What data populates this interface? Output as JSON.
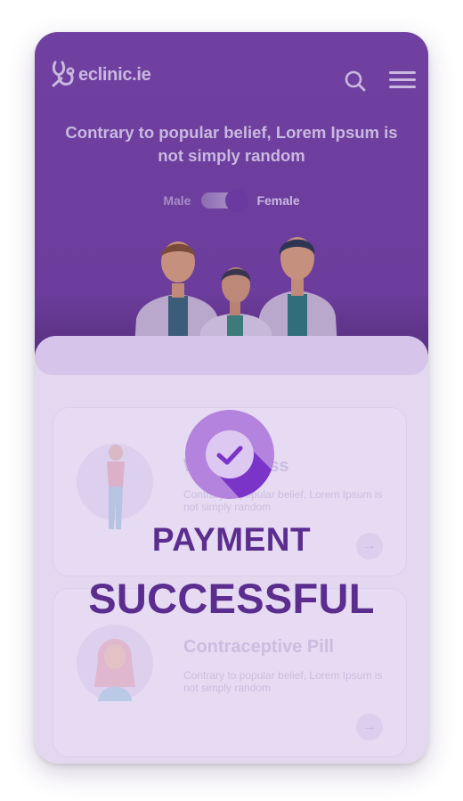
{
  "header": {
    "logo_text": "eclinic.ie",
    "icons": {
      "search": "search-icon",
      "menu": "hamburger-menu-icon"
    }
  },
  "hero": {
    "headline": "Contrary to popular belief, Lorem Ipsum is not simply random",
    "toggle": {
      "left_label": "Male",
      "right_label": "Female",
      "selected": "Female"
    }
  },
  "cards": [
    {
      "title": "Weight Loss",
      "description": "Contrary to popular belief, Lorem Ipsum is not simply random",
      "arrow_icon": "arrow-right-icon"
    },
    {
      "title": "Contraceptive Pill",
      "description": "Contrary to popular belief, Lorem Ipsum is not simply random",
      "arrow_icon": "arrow-right-icon"
    }
  ],
  "overlay": {
    "status_icon": "check-circle-icon",
    "line1": "PAYMENT",
    "line2": "SUCCESSFUL"
  },
  "colors": {
    "brand_purple": "#6c3d9c",
    "success_text": "#5b2d8e",
    "overlay_tint": "#e4d8f1"
  }
}
